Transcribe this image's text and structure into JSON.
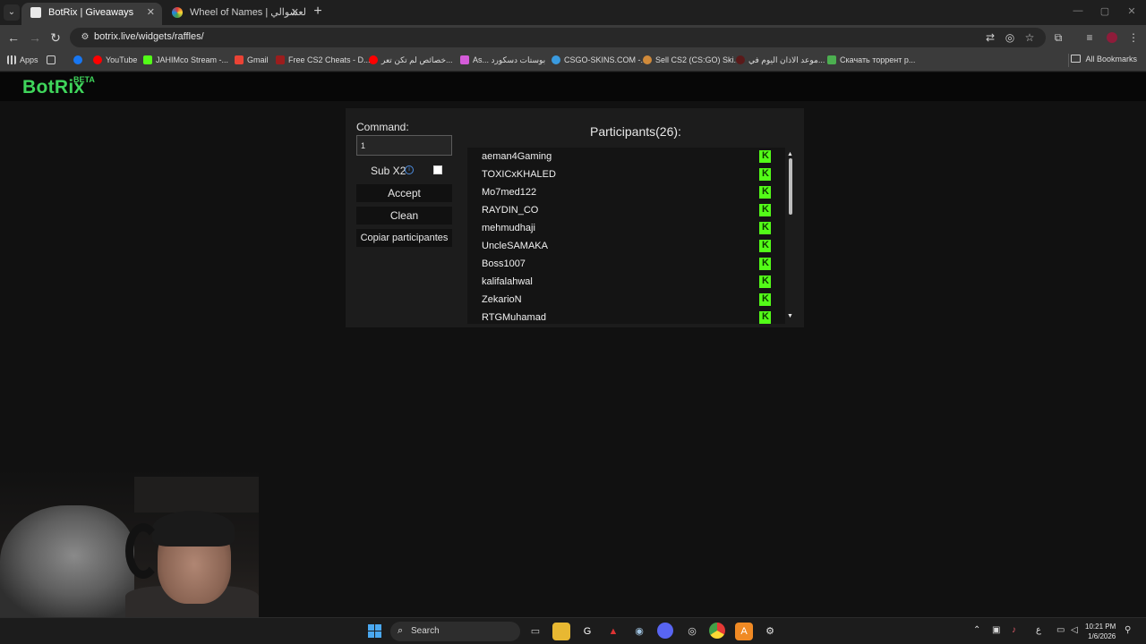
{
  "browser": {
    "tabs": [
      {
        "title": "BotRix | Giveaways",
        "active": true
      },
      {
        "title": "Wheel of Names | عسم العشوالي",
        "active": false
      }
    ],
    "url": "botrix.live/widgets/raffles/",
    "bookmarks": [
      "Apps",
      "YouTube",
      "JAHIMco Stream -...",
      "Gmail",
      "Free CS2 Cheats - D...",
      "خصائص لم تكن تعر...",
      "As... بوستات دسكورد",
      "CSGO-SKINS.COM -...",
      "Sell CS2 (CS:GO) Ski...",
      "موعد الاذان اليوم في...",
      "Скачать торрент р..."
    ],
    "all_bookmarks": "All Bookmarks"
  },
  "site": {
    "logo": "BotRix",
    "beta": "BETA"
  },
  "raffle": {
    "command_label": "Command:",
    "command_value": "1",
    "sub_label": "Sub X2",
    "accept_label": "Accept",
    "clean_label": "Clean",
    "copy_label": "Copiar participantes",
    "participants_title": "Participants(26):",
    "participants": [
      "aeman4Gaming",
      "TOXICxKHALED",
      "Mo7med122",
      "RAYDIN_CO",
      "mehmudhaji",
      "UncleSAMAKA",
      "Boss1007",
      "kalifalahwal",
      "ZekarioN",
      "RTGMuhamad"
    ]
  },
  "taskbar": {
    "search_label": "Search",
    "time": "10:21 PM",
    "date": "1/6/2026",
    "lang": "ع"
  },
  "colors": {
    "brand_green": "#3fd55b",
    "kick_green": "#53fc18",
    "info_blue": "#4d8de0"
  }
}
